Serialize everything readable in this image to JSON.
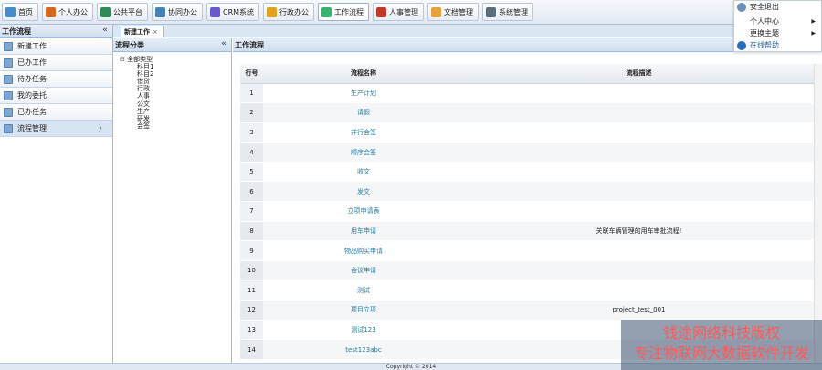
{
  "nav": {
    "items": [
      {
        "label": "首页",
        "color": "#4a89c8"
      },
      {
        "label": "个人办公",
        "color": "#d2691e"
      },
      {
        "label": "公共平台",
        "color": "#2e8b57"
      },
      {
        "label": "协同办公",
        "color": "#4682b4"
      },
      {
        "label": "CRM系统",
        "color": "#6a5acd"
      },
      {
        "label": "行政办公",
        "color": "#e0a020"
      },
      {
        "label": "工作流程",
        "color": "#3cb371"
      },
      {
        "label": "人事管理",
        "color": "#c0392b"
      },
      {
        "label": "文档管理",
        "color": "#e6a23c"
      },
      {
        "label": "系统管理",
        "color": "#5d6d7e"
      }
    ]
  },
  "user_menu": {
    "logout": "安全退出",
    "personal_center": "个人中心",
    "change_theme": "更换主题",
    "help": "在线帮助"
  },
  "sidebar": {
    "title": "工作流程",
    "collapse": "«",
    "items": [
      {
        "label": "新建工作"
      },
      {
        "label": "已办工作"
      },
      {
        "label": "待办任务"
      },
      {
        "label": "我的委托"
      },
      {
        "label": "已办任务"
      },
      {
        "label": "流程管理"
      }
    ],
    "chevron": "〉"
  },
  "tabs": {
    "active_label": "新建工作",
    "close": "×"
  },
  "category": {
    "title": "流程分类",
    "collapse": "«",
    "root": "全部类型",
    "children": [
      "科目1",
      "科目2",
      "借贷",
      "行政",
      "人事",
      "公文",
      "生产",
      "研发",
      "会签"
    ]
  },
  "main": {
    "title": "工作流程",
    "columns": [
      "行号",
      "流程名称",
      "流程描述"
    ],
    "rows": [
      {
        "num": "1",
        "name": "生产计划",
        "desc": ""
      },
      {
        "num": "2",
        "name": "请假",
        "desc": ""
      },
      {
        "num": "3",
        "name": "并行会签",
        "desc": ""
      },
      {
        "num": "4",
        "name": "顺序会签",
        "desc": ""
      },
      {
        "num": "5",
        "name": "收文",
        "desc": ""
      },
      {
        "num": "6",
        "name": "发文",
        "desc": ""
      },
      {
        "num": "7",
        "name": "立项申请表",
        "desc": ""
      },
      {
        "num": "8",
        "name": "用车申请",
        "desc": "关联车辆管理的用车审批流程!"
      },
      {
        "num": "9",
        "name": "物品购买申请",
        "desc": ""
      },
      {
        "num": "10",
        "name": "会议申请",
        "desc": ""
      },
      {
        "num": "11",
        "name": "测试",
        "desc": ""
      },
      {
        "num": "12",
        "name": "项目立项",
        "desc": "project_test_001"
      },
      {
        "num": "13",
        "name": "测试123",
        "desc": ""
      },
      {
        "num": "14",
        "name": "test123abc",
        "desc": ""
      }
    ]
  },
  "footer": "Copyright © 2014",
  "watermark": {
    "line1": "钱途网络科技版权",
    "line2": "专注物联网大数据软件开发"
  }
}
